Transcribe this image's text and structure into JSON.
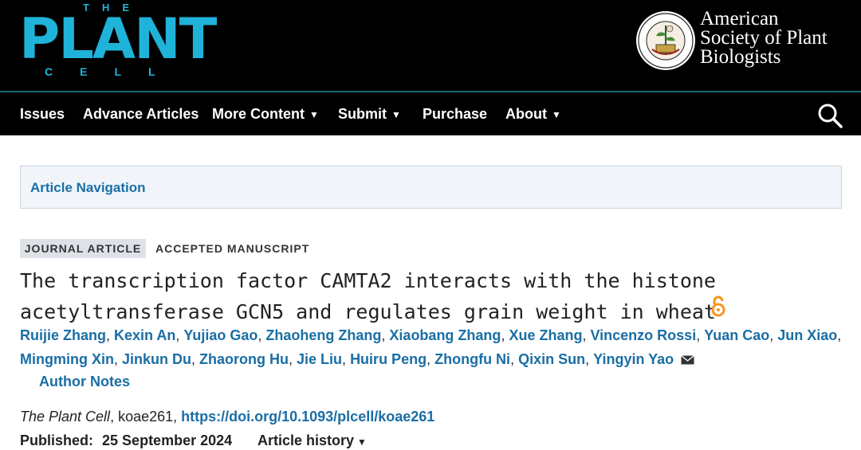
{
  "header": {
    "logo": {
      "the": "THE",
      "plant": "PLANT",
      "cell": "CELL"
    },
    "society": {
      "line1": "American",
      "line2": "Society of Plant",
      "line3": "Biologists"
    }
  },
  "nav": {
    "items": [
      {
        "label": "Issues",
        "caret": ""
      },
      {
        "label": "Advance Articles",
        "caret": ""
      },
      {
        "label": "More Content",
        "caret": "▼"
      },
      {
        "label": "Submit",
        "caret": "▼"
      },
      {
        "label": "Purchase",
        "caret": ""
      },
      {
        "label": "About",
        "caret": "▼"
      }
    ],
    "search_icon": "search-icon"
  },
  "article_navigation": {
    "label": "Article Navigation"
  },
  "article": {
    "type_badge": "JOURNAL ARTICLE",
    "status_badge": "ACCEPTED MANUSCRIPT",
    "title_line1": "The transcription factor CAMTA2 interacts with the histone",
    "title_line2": "acetyltransferase GCN5 and regulates grain weight in wheat",
    "open_access_icon": "open-access-icon",
    "authors": [
      "Ruijie Zhang",
      "Kexin An",
      "Yujiao Gao",
      "Zhaoheng Zhang",
      "Xiaobang Zhang",
      "Xue Zhang",
      "Vincenzo Rossi",
      "Yuan Cao",
      "Jun Xiao",
      "Mingming Xin",
      "Jinkun Du",
      "Zhaorong Hu",
      "Jie Liu",
      "Huiru Peng",
      "Zhongfu Ni",
      "Qixin Sun",
      "Yingyin Yao"
    ],
    "author_notes": "Author Notes",
    "citation": {
      "journal": "The Plant Cell",
      "article_id": ", koae261, ",
      "doi": "https://doi.org/10.1093/plcell/koae261"
    },
    "published_label": "Published:",
    "published_date": "25 September 2024",
    "history_label": "Article history",
    "history_caret": "▼"
  },
  "colors": {
    "header_bg": "#000000",
    "logo_cyan": "#1fb3d9",
    "link_blue": "#1a6ea5",
    "open_access_orange": "#f7941d"
  }
}
